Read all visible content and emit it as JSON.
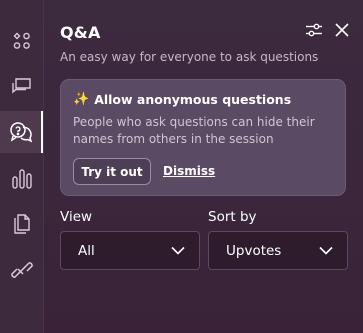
{
  "rail": {
    "items": [
      {
        "icon": "apps-grid-icon"
      },
      {
        "icon": "chat-icon"
      },
      {
        "icon": "qa-icon",
        "active": true
      },
      {
        "icon": "poll-chart-icon"
      },
      {
        "icon": "files-icon"
      },
      {
        "icon": "link-icon"
      }
    ]
  },
  "header": {
    "title": "Q&A",
    "subtitle": "An easy way for everyone to ask questions"
  },
  "card": {
    "sparkle": "✨",
    "title": "Allow anonymous questions",
    "body": "People who ask questions can hide their names from others in the session",
    "try_label": "Try it out",
    "dismiss_label": "Dismiss"
  },
  "filters": {
    "view_label": "View",
    "view_value": "All",
    "sort_label": "Sort by",
    "sort_value": "Upvotes"
  },
  "colors": {
    "background": "#3a2438",
    "card": "#5a4a63",
    "select_bg": "#2e1b2c",
    "sparkle": "#f7c948"
  }
}
